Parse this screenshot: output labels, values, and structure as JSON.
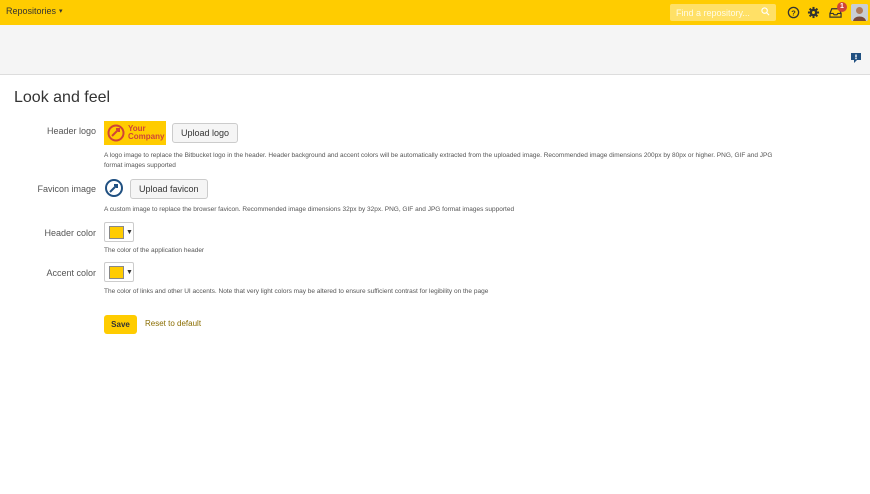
{
  "header": {
    "repositories_label": "Repositories",
    "search_placeholder": "Find a repository...",
    "notification_count": "1",
    "accent_color": "#ffcc00"
  },
  "page": {
    "title": "Look and feel"
  },
  "form": {
    "header_logo": {
      "label": "Header logo",
      "logo_text_line1": "Your",
      "logo_text_line2": "Company",
      "upload_label": "Upload logo",
      "help_line1": "A logo image to replace the Bitbucket logo in the header. Header background and accent colors will be automatically extracted from the uploaded image. Recommended image dimensions 200px by 80px or higher. PNG, GIF and JPG",
      "help_line2": "format images supported"
    },
    "favicon": {
      "label": "Favicon image",
      "upload_label": "Upload favicon",
      "help": "A custom image to replace the browser favicon. Recommended image dimensions 32px by 32px. PNG, GIF and JPG format images supported"
    },
    "header_color": {
      "label": "Header color",
      "value": "#ffcc00",
      "help": "The color of the application header"
    },
    "accent_color": {
      "label": "Accent color",
      "value": "#ffcc00",
      "help": "The color of links and other UI accents. Note that very light colors may be altered to ensure sufficient contrast for legibility on the page"
    },
    "save_label": "Save",
    "reset_label": "Reset to default"
  }
}
